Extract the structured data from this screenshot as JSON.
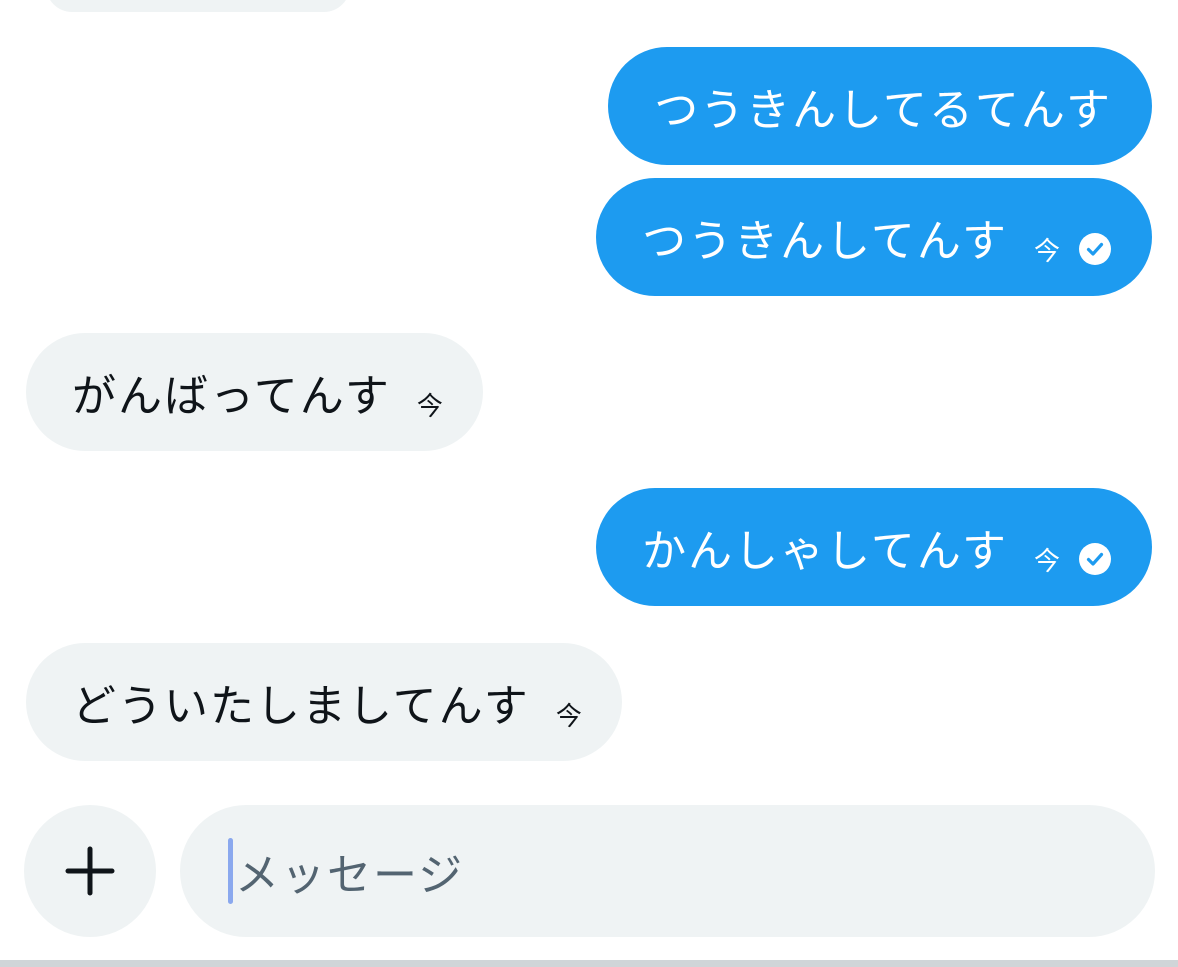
{
  "conversation": {
    "messages": [
      {
        "direction": "outgoing",
        "text": "つうきんしてるてんす",
        "time": "",
        "read": false
      },
      {
        "direction": "outgoing",
        "text": "つうきんしてんす",
        "time": "今",
        "read": true
      },
      {
        "direction": "incoming",
        "text": "がんばってんす",
        "time": "今"
      },
      {
        "direction": "outgoing",
        "text": "かんしゃしてんす",
        "time": "今",
        "read": true
      },
      {
        "direction": "incoming",
        "text": "どういたしましてんす",
        "time": "今"
      }
    ]
  },
  "composer": {
    "placeholder": "メッセージ",
    "add_icon": "plus-icon"
  },
  "colors": {
    "outgoing_bubble": "#1d9bf0",
    "incoming_bubble": "#eff3f4",
    "caret": "#8aa8ee"
  }
}
